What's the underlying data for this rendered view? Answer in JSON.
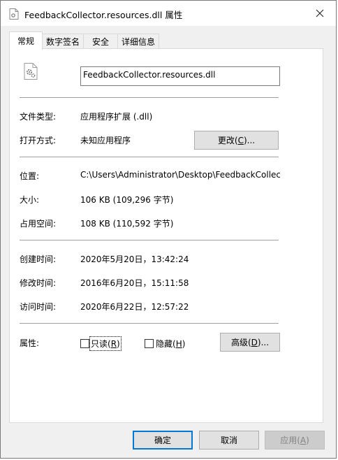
{
  "window": {
    "title": "FeedbackCollector.resources.dll 属性"
  },
  "tabs": [
    {
      "label": "常规"
    },
    {
      "label": "数字签名"
    },
    {
      "label": "安全"
    },
    {
      "label": "详细信息"
    }
  ],
  "general": {
    "file_name": "FeedbackCollector.resources.dll",
    "file_type_label": "文件类型:",
    "file_type_value": "应用程序扩展 (.dll)",
    "opens_with_label": "打开方式:",
    "opens_with_value": "未知应用程序",
    "change_button": {
      "pre": "更改(",
      "key": "C",
      "post": ")..."
    },
    "location_label": "位置:",
    "location_value": "C:\\Users\\Administrator\\Desktop\\FeedbackCollect",
    "size_label": "大小:",
    "size_value": "106 KB (109,296 字节)",
    "size_on_disk_label": "占用空间:",
    "size_on_disk_value": "108 KB (110,592 字节)",
    "created_label": "创建时间:",
    "created_value": "2020年5月20日，13:42:24",
    "modified_label": "修改时间:",
    "modified_value": "2016年6月20日，15:11:58",
    "accessed_label": "访问时间:",
    "accessed_value": "2020年6月22日，12:57:22",
    "attributes_label": "属性:",
    "readonly": {
      "pre": "只读(",
      "key": "R",
      "post": ")"
    },
    "hidden": {
      "pre": "隐藏(",
      "key": "H",
      "post": ")"
    },
    "advanced_button": {
      "pre": "高级(",
      "key": "D",
      "post": ")..."
    }
  },
  "footer": {
    "ok": "确定",
    "cancel": "取消",
    "apply": {
      "pre": "应用(",
      "key": "A",
      "post": ")"
    }
  }
}
